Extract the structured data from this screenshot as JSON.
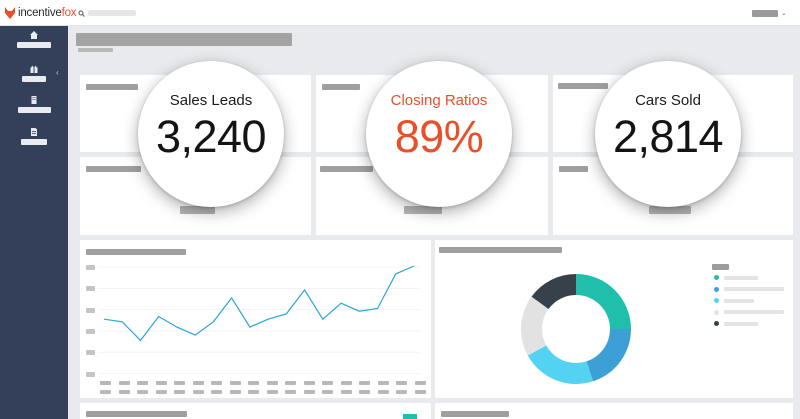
{
  "brand": {
    "name_part1": "incentive",
    "name_part2": "fox",
    "accent_color": "#e8502a"
  },
  "metrics": [
    {
      "label": "Sales Leads",
      "value": "3,240"
    },
    {
      "label": "Closing Ratios",
      "value": "89%"
    },
    {
      "label": "Cars Sold",
      "value": "2,814"
    }
  ],
  "icons": {
    "search": "search-icon",
    "nav": [
      "home-icon",
      "gift-icon",
      "building-icon",
      "document-icon"
    ],
    "collapse": "chevron-left-icon",
    "user": "chevron-down-icon"
  },
  "line_chart": {
    "type": "line",
    "series_color": "#2aa5d6",
    "values": [
      44,
      43,
      36,
      45,
      41,
      38,
      43,
      52,
      41,
      44,
      46,
      55,
      44,
      50,
      47,
      48,
      61,
      64
    ]
  },
  "donut_chart": {
    "type": "pie",
    "slices": [
      {
        "value": 25,
        "color": "#1fbfab"
      },
      {
        "value": 20,
        "color": "#3c9fd6"
      },
      {
        "value": 22,
        "color": "#54d2f1"
      },
      {
        "value": 18,
        "color": "#e2e2e2"
      },
      {
        "value": 15,
        "color": "#37414a"
      }
    ],
    "legend_colors": [
      "#1fbfab",
      "#3c9fd6",
      "#54d2f1",
      "#e4e4e4",
      "#37414a"
    ]
  }
}
